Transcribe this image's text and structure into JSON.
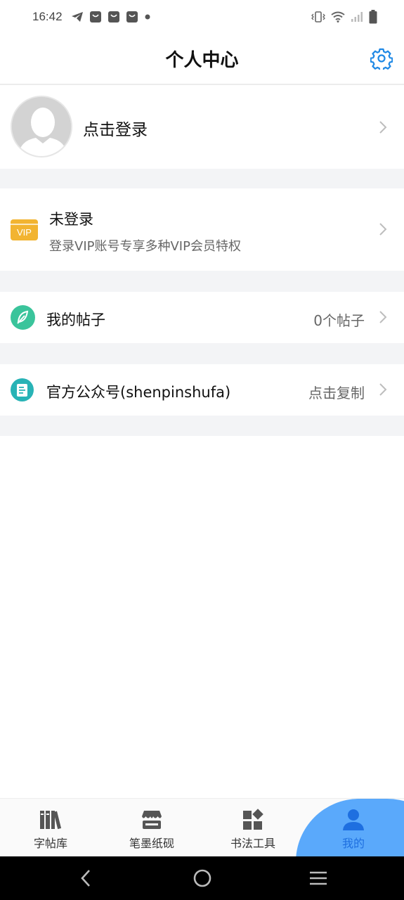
{
  "status_bar": {
    "time": "16:42",
    "left_icons": [
      "telegram-icon",
      "shopping-bag-icon",
      "shopping-bag-icon",
      "shopping-bag-icon",
      "dot-icon"
    ],
    "right_icons": [
      "vibrate-icon",
      "wifi-icon",
      "signal-icon",
      "battery-icon"
    ]
  },
  "header": {
    "title": "个人中心",
    "settings_icon": "gear-icon",
    "accent_color": "#1e88e5"
  },
  "login": {
    "label": "点击登录",
    "avatar_icon": "default-avatar-icon"
  },
  "vip": {
    "badge_text": "VIP",
    "title": "未登录",
    "subtitle": "登录VIP账号专享多种VIP会员特权",
    "badge_color": "#f2b431"
  },
  "posts": {
    "label": "我的帖子",
    "count": "0个帖子",
    "icon": "feather-icon"
  },
  "official": {
    "label": "官方公众号(shenpinshufa)",
    "action": "点击复制",
    "icon": "document-icon"
  },
  "tabs": [
    {
      "label": "字帖库",
      "icon": "books-icon",
      "active": false
    },
    {
      "label": "笔墨纸砚",
      "icon": "store-icon",
      "active": false
    },
    {
      "label": "书法工具",
      "icon": "tools-grid-icon",
      "active": false
    },
    {
      "label": "我的",
      "icon": "person-icon",
      "active": true
    }
  ],
  "system_nav": [
    "back-icon",
    "home-icon",
    "recents-icon"
  ]
}
